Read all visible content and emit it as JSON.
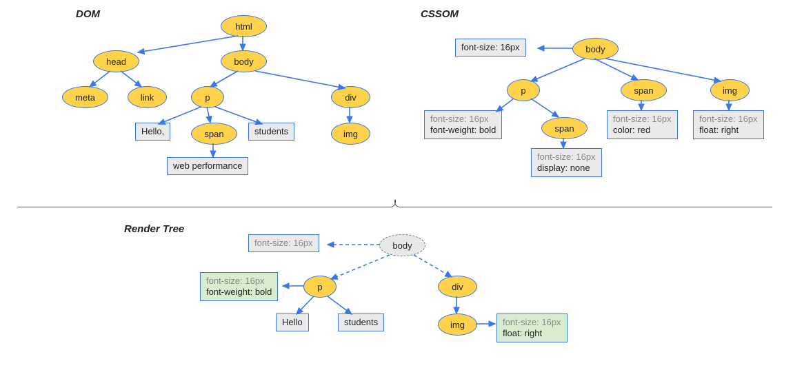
{
  "titles": {
    "dom": "DOM",
    "cssom": "CSSOM",
    "render": "Render Tree"
  },
  "dom": {
    "html": "html",
    "head": "head",
    "body": "body",
    "meta": "meta",
    "link": "link",
    "p": "p",
    "span": "span",
    "div": "div",
    "img": "img",
    "hello": "Hello,",
    "students": "students",
    "wperf": "web performance"
  },
  "cssom": {
    "body": "body",
    "p": "p",
    "span": "span",
    "img": "img",
    "span2": "span",
    "body_css": {
      "l1": "font-size: 16px"
    },
    "p_css": {
      "l1": "font-size: 16px",
      "l2": "font-weight: bold"
    },
    "span_css": {
      "l1": "font-size: 16px",
      "l2": "color: red"
    },
    "img_css": {
      "l1": "font-size: 16px",
      "l2": "float: right"
    },
    "span2_css": {
      "l1": "font-size: 16px",
      "l2": "display: none"
    }
  },
  "render": {
    "body": "body",
    "p": "p",
    "div": "div",
    "img": "img",
    "hello": "Hello",
    "students": "students",
    "body_css": {
      "l1": "font-size: 16px"
    },
    "p_css": {
      "l1": "font-size: 16px",
      "l2": "font-weight: bold"
    },
    "img_css": {
      "l1": "font-size: 16px",
      "l2": "float: right"
    }
  }
}
